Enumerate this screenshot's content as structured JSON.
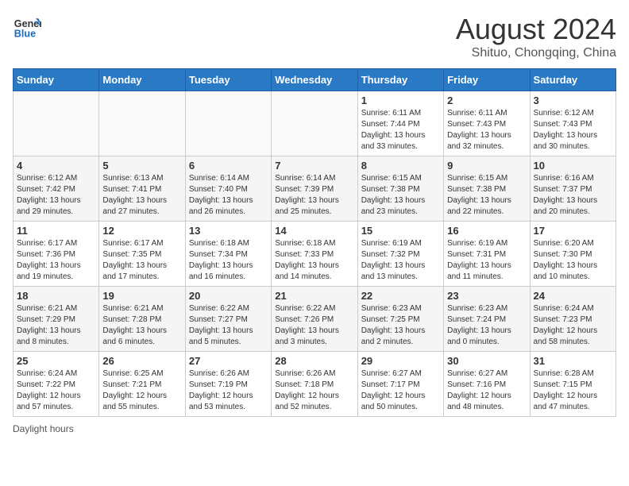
{
  "header": {
    "logo_line1": "General",
    "logo_line2": "Blue",
    "main_title": "August 2024",
    "subtitle": "Shituo, Chongqing, China"
  },
  "days_of_week": [
    "Sunday",
    "Monday",
    "Tuesday",
    "Wednesday",
    "Thursday",
    "Friday",
    "Saturday"
  ],
  "weeks": [
    [
      {
        "day": "",
        "info": ""
      },
      {
        "day": "",
        "info": ""
      },
      {
        "day": "",
        "info": ""
      },
      {
        "day": "",
        "info": ""
      },
      {
        "day": "1",
        "info": "Sunrise: 6:11 AM\nSunset: 7:44 PM\nDaylight: 13 hours and 33 minutes."
      },
      {
        "day": "2",
        "info": "Sunrise: 6:11 AM\nSunset: 7:43 PM\nDaylight: 13 hours and 32 minutes."
      },
      {
        "day": "3",
        "info": "Sunrise: 6:12 AM\nSunset: 7:43 PM\nDaylight: 13 hours and 30 minutes."
      }
    ],
    [
      {
        "day": "4",
        "info": "Sunrise: 6:12 AM\nSunset: 7:42 PM\nDaylight: 13 hours and 29 minutes."
      },
      {
        "day": "5",
        "info": "Sunrise: 6:13 AM\nSunset: 7:41 PM\nDaylight: 13 hours and 27 minutes."
      },
      {
        "day": "6",
        "info": "Sunrise: 6:14 AM\nSunset: 7:40 PM\nDaylight: 13 hours and 26 minutes."
      },
      {
        "day": "7",
        "info": "Sunrise: 6:14 AM\nSunset: 7:39 PM\nDaylight: 13 hours and 25 minutes."
      },
      {
        "day": "8",
        "info": "Sunrise: 6:15 AM\nSunset: 7:38 PM\nDaylight: 13 hours and 23 minutes."
      },
      {
        "day": "9",
        "info": "Sunrise: 6:15 AM\nSunset: 7:38 PM\nDaylight: 13 hours and 22 minutes."
      },
      {
        "day": "10",
        "info": "Sunrise: 6:16 AM\nSunset: 7:37 PM\nDaylight: 13 hours and 20 minutes."
      }
    ],
    [
      {
        "day": "11",
        "info": "Sunrise: 6:17 AM\nSunset: 7:36 PM\nDaylight: 13 hours and 19 minutes."
      },
      {
        "day": "12",
        "info": "Sunrise: 6:17 AM\nSunset: 7:35 PM\nDaylight: 13 hours and 17 minutes."
      },
      {
        "day": "13",
        "info": "Sunrise: 6:18 AM\nSunset: 7:34 PM\nDaylight: 13 hours and 16 minutes."
      },
      {
        "day": "14",
        "info": "Sunrise: 6:18 AM\nSunset: 7:33 PM\nDaylight: 13 hours and 14 minutes."
      },
      {
        "day": "15",
        "info": "Sunrise: 6:19 AM\nSunset: 7:32 PM\nDaylight: 13 hours and 13 minutes."
      },
      {
        "day": "16",
        "info": "Sunrise: 6:19 AM\nSunset: 7:31 PM\nDaylight: 13 hours and 11 minutes."
      },
      {
        "day": "17",
        "info": "Sunrise: 6:20 AM\nSunset: 7:30 PM\nDaylight: 13 hours and 10 minutes."
      }
    ],
    [
      {
        "day": "18",
        "info": "Sunrise: 6:21 AM\nSunset: 7:29 PM\nDaylight: 13 hours and 8 minutes."
      },
      {
        "day": "19",
        "info": "Sunrise: 6:21 AM\nSunset: 7:28 PM\nDaylight: 13 hours and 6 minutes."
      },
      {
        "day": "20",
        "info": "Sunrise: 6:22 AM\nSunset: 7:27 PM\nDaylight: 13 hours and 5 minutes."
      },
      {
        "day": "21",
        "info": "Sunrise: 6:22 AM\nSunset: 7:26 PM\nDaylight: 13 hours and 3 minutes."
      },
      {
        "day": "22",
        "info": "Sunrise: 6:23 AM\nSunset: 7:25 PM\nDaylight: 13 hours and 2 minutes."
      },
      {
        "day": "23",
        "info": "Sunrise: 6:23 AM\nSunset: 7:24 PM\nDaylight: 13 hours and 0 minutes."
      },
      {
        "day": "24",
        "info": "Sunrise: 6:24 AM\nSunset: 7:23 PM\nDaylight: 12 hours and 58 minutes."
      }
    ],
    [
      {
        "day": "25",
        "info": "Sunrise: 6:24 AM\nSunset: 7:22 PM\nDaylight: 12 hours and 57 minutes."
      },
      {
        "day": "26",
        "info": "Sunrise: 6:25 AM\nSunset: 7:21 PM\nDaylight: 12 hours and 55 minutes."
      },
      {
        "day": "27",
        "info": "Sunrise: 6:26 AM\nSunset: 7:19 PM\nDaylight: 12 hours and 53 minutes."
      },
      {
        "day": "28",
        "info": "Sunrise: 6:26 AM\nSunset: 7:18 PM\nDaylight: 12 hours and 52 minutes."
      },
      {
        "day": "29",
        "info": "Sunrise: 6:27 AM\nSunset: 7:17 PM\nDaylight: 12 hours and 50 minutes."
      },
      {
        "day": "30",
        "info": "Sunrise: 6:27 AM\nSunset: 7:16 PM\nDaylight: 12 hours and 48 minutes."
      },
      {
        "day": "31",
        "info": "Sunrise: 6:28 AM\nSunset: 7:15 PM\nDaylight: 12 hours and 47 minutes."
      }
    ]
  ],
  "footer": {
    "note": "Daylight hours"
  }
}
